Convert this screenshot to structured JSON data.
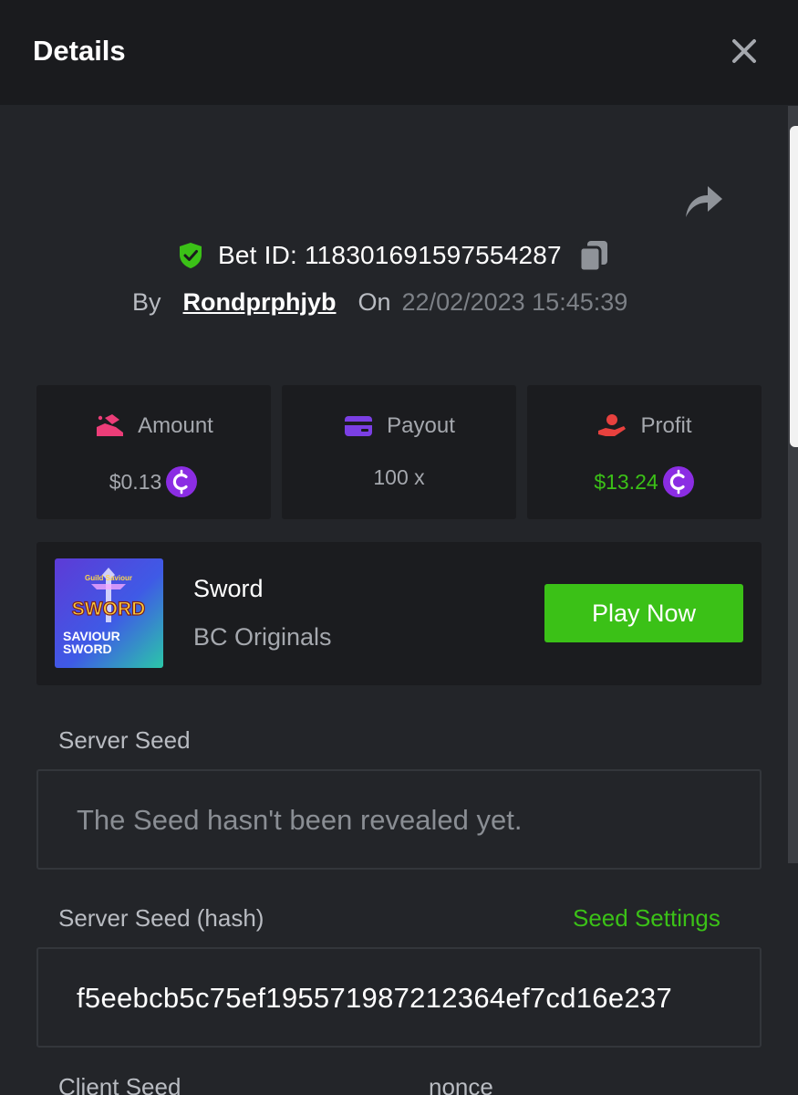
{
  "header": {
    "title": "Details"
  },
  "bet": {
    "bet_id_text": "Bet ID: 118301691597554287",
    "by_label": "By",
    "username": "Rondprphjyb",
    "on_label": "On",
    "datetime": "22/02/2023 15:45:39"
  },
  "stats": {
    "amount": {
      "label": "Amount",
      "value": "$0.13",
      "icon": "coins-hand-icon",
      "currency_icon": "bcd-coin-icon"
    },
    "payout": {
      "label": "Payout",
      "value": "100 x",
      "icon": "credit-card-icon"
    },
    "profit": {
      "label": "Profit",
      "value": "$13.24",
      "icon": "money-hand-icon",
      "currency_icon": "bcd-coin-icon"
    }
  },
  "game": {
    "name": "Sword",
    "provider": "BC Originals",
    "thumb_title": "SWORD",
    "thumb_subtitle_top": "SAVIOUR",
    "thumb_subtitle_bottom": "SWORD",
    "thumb_small": "Guild Saviour",
    "play_label": "Play Now"
  },
  "seeds": {
    "server_seed_label": "Server Seed",
    "server_seed_placeholder": "The Seed hasn't been revealed yet.",
    "server_seed_hash_label": "Server Seed (hash)",
    "seed_settings_label": "Seed Settings",
    "server_seed_hash_value": "f5eebcb5c75ef195571987212364ef7cd16e237",
    "client_seed_label": "Client Seed",
    "nonce_label": "nonce"
  },
  "colors": {
    "accent_green": "#3bc117",
    "coin_purple": "#8b2de3",
    "amount_pink": "#ec3d78",
    "payout_purple": "#7b3fe4",
    "profit_red": "#e8413e"
  }
}
